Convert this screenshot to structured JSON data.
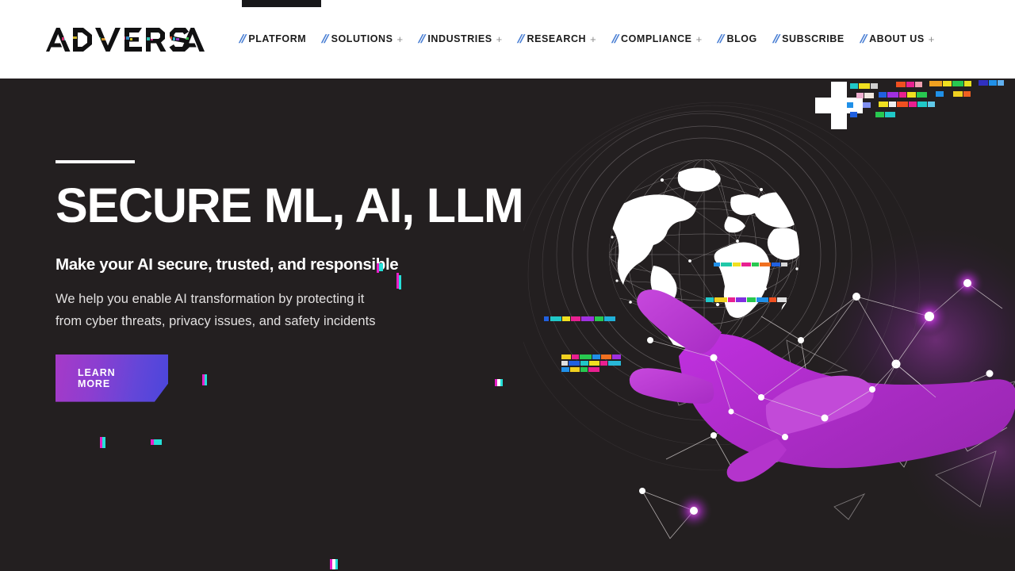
{
  "site": {
    "brand": "ADVERSA",
    "brand_icon": "adversa-logo"
  },
  "header": {
    "nav": [
      {
        "label": "PLATFORM",
        "slash": "//",
        "plus": "",
        "has_plus": false
      },
      {
        "label": "SOLUTIONS",
        "slash": "//",
        "plus": "+",
        "has_plus": true
      },
      {
        "label": "INDUSTRIES",
        "slash": "//",
        "plus": "+",
        "has_plus": true
      },
      {
        "label": "RESEARCH",
        "slash": "//",
        "plus": "+",
        "has_plus": true
      },
      {
        "label": "COMPLIANCE",
        "slash": "//",
        "plus": "+",
        "has_plus": true
      },
      {
        "label": "BLOG",
        "slash": "//",
        "plus": "",
        "has_plus": false
      },
      {
        "label": "SUBSCRIBE",
        "slash": "//",
        "plus": "",
        "has_plus": false
      },
      {
        "label": "ABOUT US",
        "slash": "//",
        "plus": "+",
        "has_plus": true
      }
    ]
  },
  "hero": {
    "headline": "SECURE ML, AI, LLM",
    "subheadline": "Make your AI secure, trusted, and responsible",
    "body_line_1": "We help you enable AI transformation by protecting it",
    "body_line_2": "from cyber threats, privacy issues, and safety incidents",
    "cta_label": "LEARN MORE",
    "art_description": "globe-with-hand-illustration"
  },
  "colors": {
    "header_bg": "#ffffff",
    "hero_bg": "#231f20",
    "nav_text": "#1b1b1b",
    "slash_blue": "#4a7fd4",
    "accent_magenta": "#a63ac8",
    "accent_blue": "#4a46dc",
    "hand_purple": "#b12fd0",
    "glitch_magenta": "#e820c8",
    "glitch_cyan": "#26e0d8",
    "text_white": "#ffffff"
  }
}
